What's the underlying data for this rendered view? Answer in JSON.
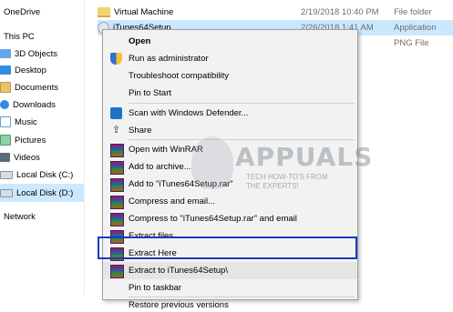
{
  "nav": {
    "items": [
      {
        "label": "OneDrive",
        "icon": "onedrive-icon"
      },
      {
        "label": "This PC",
        "icon": "pc-icon"
      },
      {
        "label": "3D Objects",
        "icon": "3d-objects-icon"
      },
      {
        "label": "Desktop",
        "icon": "desktop-icon"
      },
      {
        "label": "Documents",
        "icon": "documents-icon"
      },
      {
        "label": "Downloads",
        "icon": "downloads-icon"
      },
      {
        "label": "Music",
        "icon": "music-icon"
      },
      {
        "label": "Pictures",
        "icon": "pictures-icon"
      },
      {
        "label": "Videos",
        "icon": "videos-icon"
      },
      {
        "label": "Local Disk (C:)",
        "icon": "disk-icon"
      },
      {
        "label": "Local Disk (D:)",
        "icon": "disk-icon"
      },
      {
        "label": "Network",
        "icon": "network-icon"
      }
    ]
  },
  "files": [
    {
      "name": "Virtual Machine",
      "date": "2/19/2018 10:40 PM",
      "type": "File folder",
      "icon": "folder-icon"
    },
    {
      "name": "iTunes64Setup",
      "date": "2/26/2018 1:41 AM",
      "type": "Application",
      "icon": "application-icon"
    },
    {
      "name": "",
      "date": "",
      "type": "PNG File",
      "icon": ""
    }
  ],
  "menu": {
    "items": [
      {
        "label": "Open",
        "bold": true,
        "icon": ""
      },
      {
        "label": "Run as administrator",
        "icon": "uac-shield-icon"
      },
      {
        "label": "Troubleshoot compatibility",
        "icon": ""
      },
      {
        "label": "Pin to Start",
        "icon": ""
      },
      {
        "label": "Scan with Windows Defender...",
        "icon": "defender-icon"
      },
      {
        "label": "Share",
        "icon": "share-icon"
      },
      {
        "label": "Open with WinRAR",
        "icon": "winrar-icon"
      },
      {
        "label": "Add to archive...",
        "icon": "winrar-icon"
      },
      {
        "label": "Add to \"iTunes64Setup.rar\"",
        "icon": "winrar-icon"
      },
      {
        "label": "Compress and email...",
        "icon": "winrar-icon"
      },
      {
        "label": "Compress to \"iTunes64Setup.rar\" and email",
        "icon": "winrar-icon"
      },
      {
        "label": "Extract files...",
        "icon": "winrar-icon"
      },
      {
        "label": "Extract Here",
        "icon": "winrar-icon"
      },
      {
        "label": "Extract to iTunes64Setup\\",
        "icon": "winrar-icon"
      },
      {
        "label": "Pin to taskbar",
        "icon": ""
      },
      {
        "label": "Restore previous versions",
        "icon": ""
      }
    ]
  },
  "watermark": {
    "brand": "APPUALS",
    "tagline_line1": "TECH HOW-TO'S FROM",
    "tagline_line2": "THE EXPERTS!"
  },
  "colors": {
    "selection": "#cce8ff",
    "highlight_border": "#1a39b8",
    "menu_bg": "#f2f2f2"
  }
}
